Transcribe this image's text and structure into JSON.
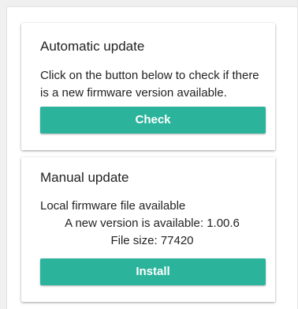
{
  "auto_update": {
    "title": "Automatic update",
    "description": "Click on the button below to check if there is a new firmware version available.",
    "button_label": "Check"
  },
  "manual_update": {
    "title": "Manual update",
    "local_label": "Local firmware file available",
    "version_text": "A new version is available: 1.00.6",
    "file_size_text": "File size: 77420",
    "button_label": "Install"
  },
  "colors": {
    "accent": "#2bb39b",
    "page_bg": "#f0f0f0",
    "card_bg": "#ffffff",
    "text": "#222222"
  }
}
